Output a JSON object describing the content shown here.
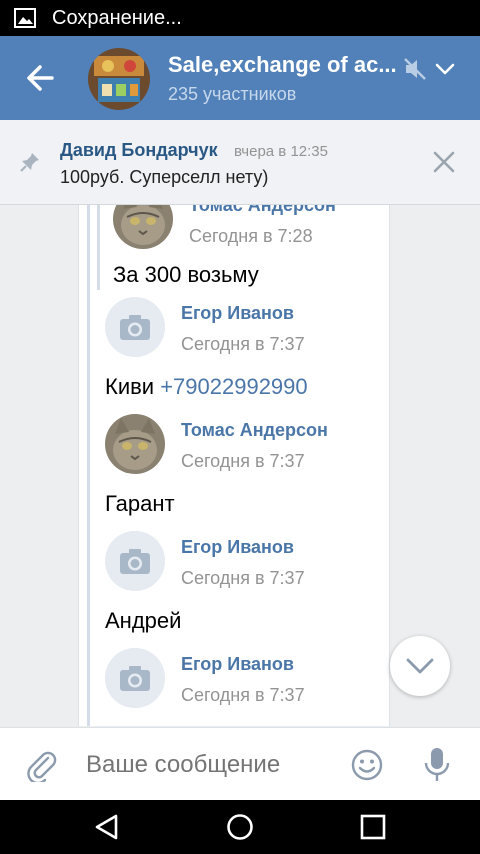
{
  "status_bar": {
    "icon": "image-icon",
    "text": "Сохранение..."
  },
  "header": {
    "title": "Sale,exchange of ac...",
    "subtitle": "235 участников",
    "accent_color": "#5181b8"
  },
  "pinned": {
    "author": "Давид Бондарчук",
    "time": "вчера в 12:35",
    "text": "100руб. Суперселл нету)"
  },
  "messages": [
    {
      "author": "Томас Андерсон",
      "time": "Сегодня в 7:28",
      "avatar": "cat-photo",
      "text": "За 300 возьму"
    },
    {
      "author": "Егор Иванов",
      "time": "Сегодня в 7:37",
      "avatar": "camera-icon",
      "text": "Киви ",
      "link": "+79022992990"
    },
    {
      "author": "Томас Андерсон",
      "time": "Сегодня в 7:37",
      "avatar": "cat-photo",
      "text": "Гарант"
    },
    {
      "author": "Егор Иванов",
      "time": "Сегодня в 7:37",
      "avatar": "camera-icon",
      "text": "Андрей"
    },
    {
      "author": "Егор Иванов",
      "time": "Сегодня в 7:37",
      "avatar": "camera-icon",
      "text": ""
    }
  ],
  "composer": {
    "placeholder": "Ваше сообщение"
  }
}
